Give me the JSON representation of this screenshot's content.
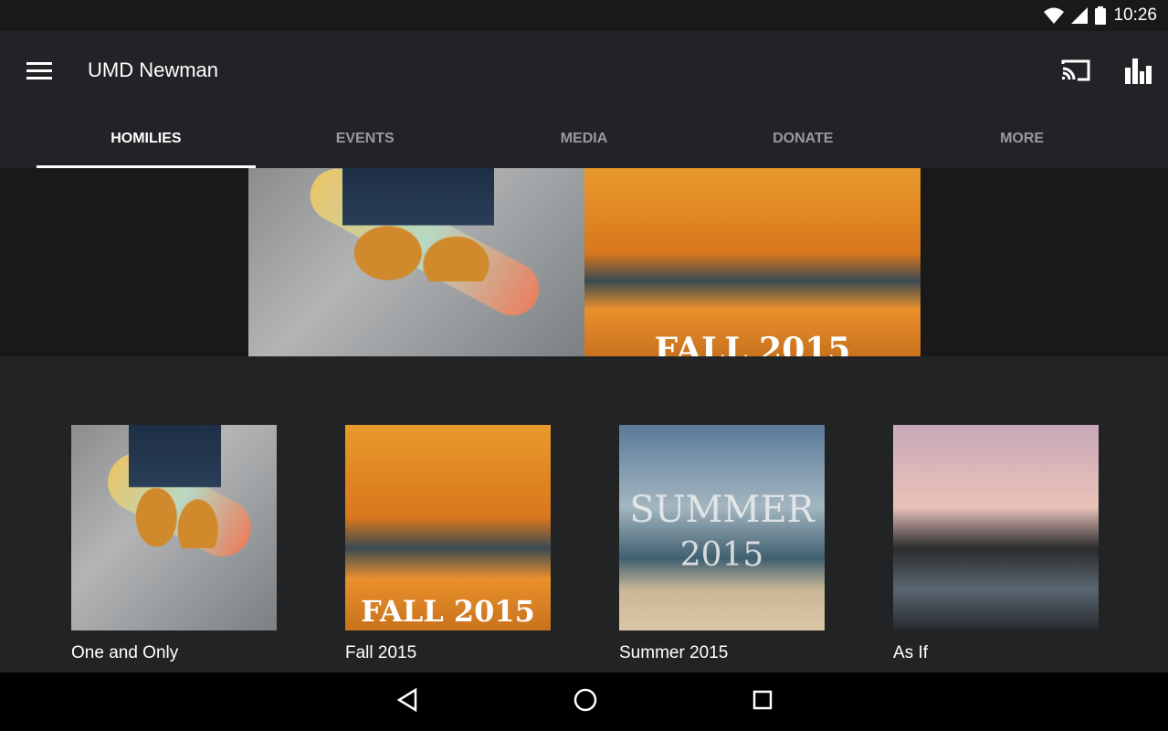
{
  "status": {
    "time": "10:26"
  },
  "appbar": {
    "title": "UMD Newman"
  },
  "tabs": [
    {
      "label": "HOMILIES"
    },
    {
      "label": "EVENTS"
    },
    {
      "label": "MEDIA"
    },
    {
      "label": "DONATE"
    },
    {
      "label": "MORE"
    }
  ],
  "banner": {
    "fall_caption": "FALL 2015"
  },
  "items": [
    {
      "title": "One and Only"
    },
    {
      "title": "Fall 2015",
      "caption": "FALL 2015"
    },
    {
      "title": "Summer 2015",
      "caption_line1": "SUMMER",
      "caption_line2": "2015"
    },
    {
      "title": "As If"
    }
  ]
}
